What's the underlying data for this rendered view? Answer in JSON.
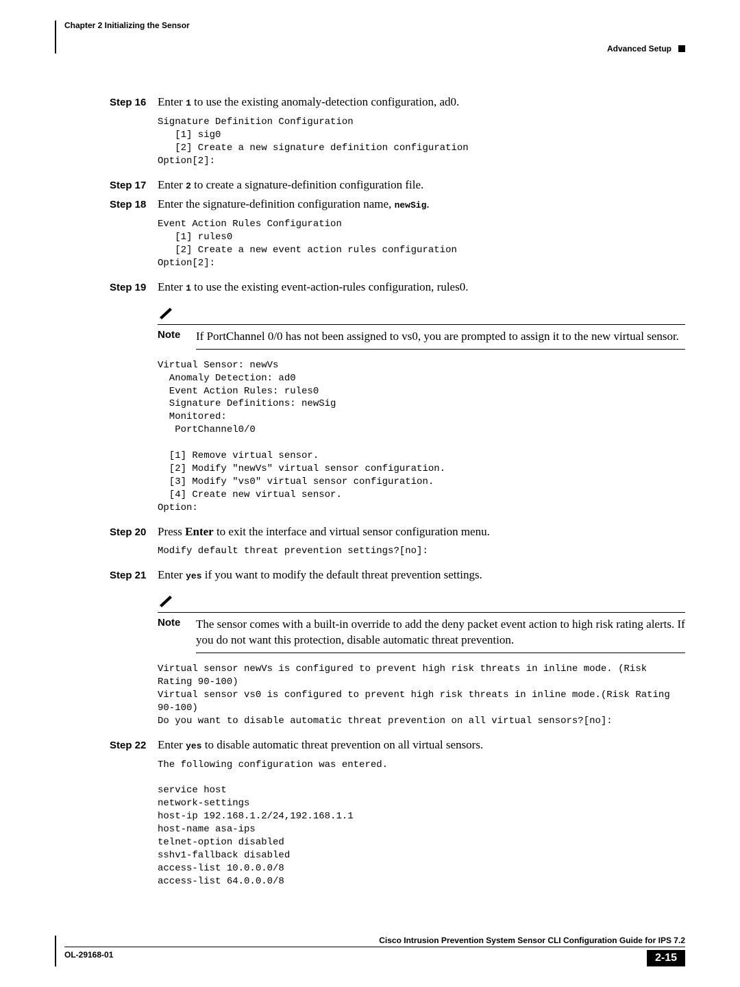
{
  "header": {
    "chapter": "Chapter 2      Initializing the Sensor",
    "section": "Advanced Setup"
  },
  "steps": {
    "s16": {
      "label": "Step 16",
      "pre": "Enter ",
      "k": "1",
      "post": " to use the existing anomaly-detection configuration, ad0."
    },
    "code16": "Signature Definition Configuration\n   [1] sig0\n   [2] Create a new signature definition configuration\nOption[2]:",
    "s17": {
      "label": "Step 17",
      "pre": "Enter ",
      "k": "2",
      "post": " to create a signature-definition configuration file."
    },
    "s18": {
      "label": "Step 18",
      "pre": "Enter the signature-definition configuration name, ",
      "k": "newSig",
      "post": "."
    },
    "code18": "Event Action Rules Configuration\n   [1] rules0\n   [2] Create a new event action rules configuration\nOption[2]:",
    "s19": {
      "label": "Step 19",
      "pre": "Enter ",
      "k": "1",
      "post": " to use the existing event-action-rules configuration, rules0."
    },
    "note19": {
      "label": "Note",
      "text": "If PortChannel 0/0 has not been assigned to vs0, you are prompted to assign it to the new virtual sensor."
    },
    "code19": "Virtual Sensor: newVs\n  Anomaly Detection: ad0\n  Event Action Rules: rules0\n  Signature Definitions: newSig\n  Monitored:\n   PortChannel0/0\n\n  [1] Remove virtual sensor.\n  [2] Modify \"newVs\" virtual sensor configuration.\n  [3] Modify \"vs0\" virtual sensor configuration.\n  [4] Create new virtual sensor.\nOption:",
    "s20": {
      "label": "Step 20",
      "pre": "Press ",
      "k": "Enter",
      "post": " to exit the interface and virtual sensor configuration menu."
    },
    "code20": "Modify default threat prevention settings?[no]:",
    "s21": {
      "label": "Step 21",
      "pre": "Enter ",
      "k": "yes",
      "post": " if you want to modify the default threat prevention settings."
    },
    "note21": {
      "label": "Note",
      "text": "The sensor comes with a built-in override to add the deny packet event action to high risk rating alerts. If you do not want this protection, disable automatic threat prevention."
    },
    "code21": "Virtual sensor newVs is configured to prevent high risk threats in inline mode. (Risk Rating 90-100)\nVirtual sensor vs0 is configured to prevent high risk threats in inline mode.(Risk Rating 90-100)\nDo you want to disable automatic threat prevention on all virtual sensors?[no]:",
    "s22": {
      "label": "Step 22",
      "pre": "Enter ",
      "k": "yes",
      "post": " to disable automatic threat prevention on all virtual sensors."
    },
    "code22": "The following configuration was entered.\n\nservice host\nnetwork-settings\nhost-ip 192.168.1.2/24,192.168.1.1\nhost-name asa-ips\ntelnet-option disabled\nsshv1-fallback disabled\naccess-list 10.0.0.0/8\naccess-list 64.0.0.0/8"
  },
  "footer": {
    "title": "Cisco Intrusion Prevention System Sensor CLI Configuration Guide for IPS 7.2",
    "ol": "OL-29168-01",
    "page": "2-15"
  }
}
